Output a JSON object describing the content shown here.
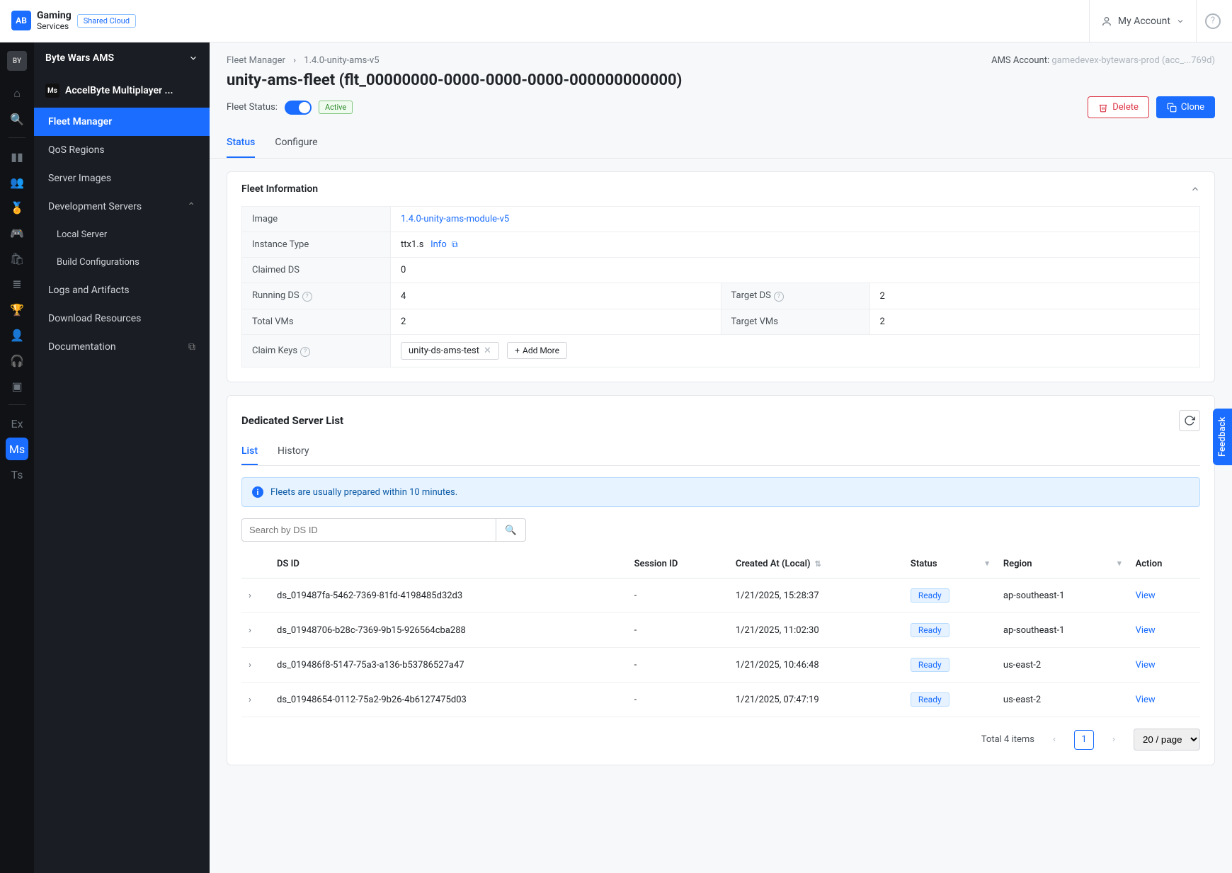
{
  "brand": {
    "name": "Gaming",
    "sub": "Services",
    "badge": "Shared Cloud",
    "logo_initials": "AB"
  },
  "account": {
    "label": "My Account"
  },
  "project": {
    "initials": "BY",
    "name": "Byte Wars AMS"
  },
  "svc_title": "AccelByte Multiplayer ...",
  "sidebar": {
    "items": [
      {
        "label": "Fleet Manager",
        "active": true
      },
      {
        "label": "QoS Regions"
      },
      {
        "label": "Server Images"
      },
      {
        "label": "Development Servers",
        "expandable": true
      },
      {
        "label": "Local Server",
        "sub": true
      },
      {
        "label": "Build Configurations",
        "sub": true
      },
      {
        "label": "Logs and Artifacts"
      },
      {
        "label": "Download Resources"
      },
      {
        "label": "Documentation",
        "ext": true
      }
    ]
  },
  "breadcrumb": {
    "root": "Fleet Manager",
    "leaf": "1.4.0-unity-ams-v5"
  },
  "ams_account": {
    "label": "AMS Account:",
    "value": "gamedevex-bytewars-prod (acc_...769d)"
  },
  "page_title": "unity-ams-fleet (flt_00000000-0000-0000-0000-000000000000)",
  "fleet_status": {
    "label": "Fleet Status:",
    "pill": "Active"
  },
  "actions": {
    "delete": "Delete",
    "clone": "Clone"
  },
  "main_tabs": [
    {
      "label": "Status",
      "active": true
    },
    {
      "label": "Configure"
    }
  ],
  "fleet_info": {
    "title": "Fleet Information",
    "image_label": "Image",
    "image_value": "1.4.0-unity-ams-module-v5",
    "instance_label": "Instance Type",
    "instance_value": "ttx1.s",
    "instance_info": "Info",
    "claimed_label": "Claimed DS",
    "claimed_value": "0",
    "running_label": "Running DS",
    "running_value": "4",
    "target_ds_label": "Target DS",
    "target_ds_value": "2",
    "total_vms_label": "Total VMs",
    "total_vms_value": "2",
    "target_vms_label": "Target VMs",
    "target_vms_value": "2",
    "claim_keys_label": "Claim Keys",
    "claim_key_tag": "unity-ds-ams-test",
    "add_more": "Add More"
  },
  "ds": {
    "title": "Dedicated Server List",
    "tabs": [
      {
        "label": "List",
        "active": true
      },
      {
        "label": "History"
      }
    ],
    "alert": "Fleets are usually prepared within 10 minutes.",
    "search_placeholder": "Search by DS ID",
    "columns": {
      "dsid": "DS ID",
      "session": "Session ID",
      "created": "Created At (Local)",
      "status": "Status",
      "region": "Region",
      "action": "Action"
    },
    "rows": [
      {
        "id": "ds_019487fa-5462-7369-81fd-4198485d32d3",
        "session": "-",
        "created": "1/21/2025, 15:28:37",
        "status": "Ready",
        "region": "ap-southeast-1",
        "action": "View"
      },
      {
        "id": "ds_01948706-b28c-7369-9b15-926564cba288",
        "session": "-",
        "created": "1/21/2025, 11:02:30",
        "status": "Ready",
        "region": "ap-southeast-1",
        "action": "View"
      },
      {
        "id": "ds_019486f8-5147-75a3-a136-b53786527a47",
        "session": "-",
        "created": "1/21/2025, 10:46:48",
        "status": "Ready",
        "region": "us-east-2",
        "action": "View"
      },
      {
        "id": "ds_01948654-0112-75a2-9b26-4b6127475d03",
        "session": "-",
        "created": "1/21/2025, 07:47:19",
        "status": "Ready",
        "region": "us-east-2",
        "action": "View"
      }
    ],
    "total": "Total 4 items",
    "page": "1",
    "per_page": "20 / page"
  },
  "feedback": "Feedback"
}
